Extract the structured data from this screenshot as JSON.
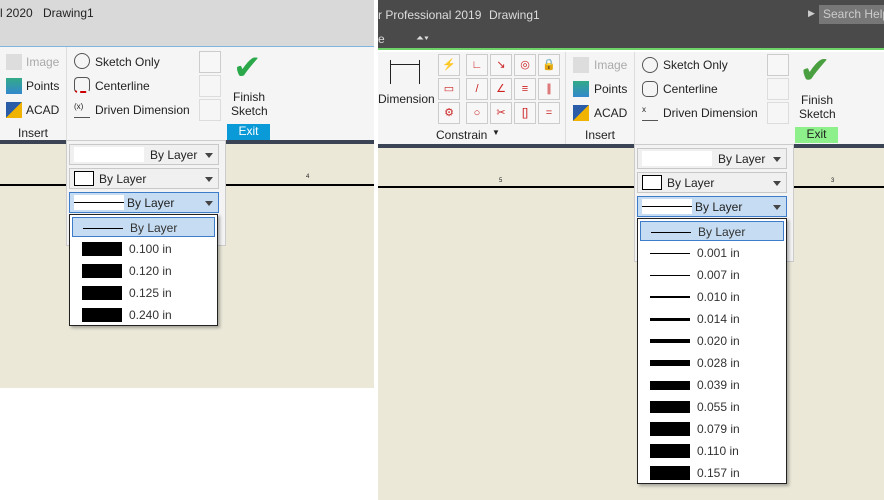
{
  "left": {
    "title_product": "l 2020",
    "title_doc": "Drawing1",
    "insert": {
      "image": "Image",
      "points": "Points",
      "acad": "ACAD",
      "group": "Insert"
    },
    "format": {
      "sketch_only": "Sketch Only",
      "centerline": "Centerline",
      "driven_dimension": "Driven Dimension"
    },
    "exit": {
      "finish": "Finish",
      "sketch": "Sketch",
      "group": "Exit"
    },
    "selects": {
      "color": "By Layer",
      "linetype": "By Layer",
      "lineweight": "By Layer"
    },
    "ruler_tick": "4",
    "lineweights": [
      "By Layer",
      "0.100 in",
      "0.120 in",
      "0.125 in",
      "0.240 in"
    ],
    "accent": "#0a9ad8"
  },
  "right": {
    "title_product": "r Professional 2019",
    "title_doc": "Drawing1",
    "search": "Search Help",
    "tab_fragment": "e",
    "dimension": "Dimension",
    "constrain": "Constrain",
    "insert": {
      "image": "Image",
      "points": "Points",
      "acad": "ACAD",
      "group": "Insert"
    },
    "format": {
      "sketch_only": "Sketch Only",
      "centerline": "Centerline",
      "driven_dimension": "Driven Dimension"
    },
    "exit": {
      "finish": "Finish",
      "sketch": "Sketch",
      "group": "Exit"
    },
    "selects": {
      "color": "By Layer",
      "linetype": "By Layer",
      "lineweight": "By Layer"
    },
    "ruler_ticks": [
      "5",
      "3"
    ],
    "lineweights": [
      "By Layer",
      "0.001 in",
      "0.007 in",
      "0.010 in",
      "0.014 in",
      "0.020 in",
      "0.028 in",
      "0.039 in",
      "0.055 in",
      "0.079 in",
      "0.110 in",
      "0.157 in"
    ],
    "accent": "#8ef08a"
  }
}
